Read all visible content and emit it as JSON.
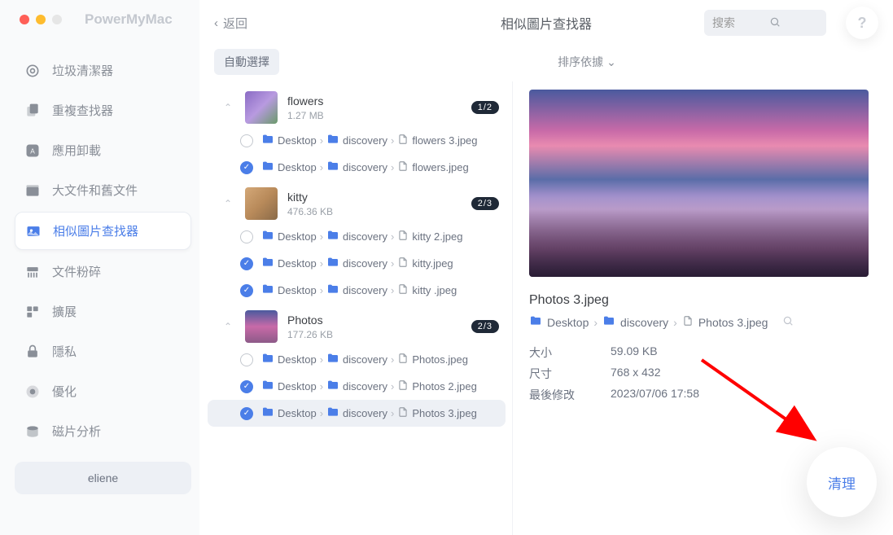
{
  "app": {
    "name": "PowerMyMac",
    "back": "返回",
    "page_title": "相似圖片查找器",
    "search_placeholder": "搜索",
    "help": "?"
  },
  "user": "eliene",
  "sidebar": {
    "items": [
      {
        "label": "垃圾清潔器",
        "icon": "broom-icon"
      },
      {
        "label": "重複查找器",
        "icon": "copy-icon"
      },
      {
        "label": "應用卸載",
        "icon": "app-icon"
      },
      {
        "label": "大文件和舊文件",
        "icon": "box-icon"
      },
      {
        "label": "相似圖片查找器",
        "icon": "image-icon"
      },
      {
        "label": "文件粉碎",
        "icon": "shred-icon"
      },
      {
        "label": "擴展",
        "icon": "puzzle-icon"
      },
      {
        "label": "隱私",
        "icon": "lock-icon"
      },
      {
        "label": "優化",
        "icon": "rocket-icon"
      },
      {
        "label": "磁片分析",
        "icon": "disk-icon"
      }
    ]
  },
  "subbar": {
    "auto_select": "自動選擇",
    "sort": "排序依據"
  },
  "groups": [
    {
      "name": "flowers",
      "size": "1.27 MB",
      "badge": "1/2",
      "thumb": "flowers",
      "files": [
        {
          "checked": false,
          "path": [
            "Desktop",
            "discovery"
          ],
          "file": "flowers 3.jpeg"
        },
        {
          "checked": true,
          "path": [
            "Desktop",
            "discovery"
          ],
          "file": "flowers.jpeg"
        }
      ]
    },
    {
      "name": "kitty",
      "size": "476.36 KB",
      "badge": "2/3",
      "thumb": "kitty",
      "files": [
        {
          "checked": false,
          "path": [
            "Desktop",
            "discovery"
          ],
          "file": "kitty 2.jpeg"
        },
        {
          "checked": true,
          "path": [
            "Desktop",
            "discovery"
          ],
          "file": "kitty.jpeg"
        },
        {
          "checked": true,
          "path": [
            "Desktop",
            "discovery"
          ],
          "file": "kitty .jpeg"
        }
      ]
    },
    {
      "name": "Photos",
      "size": "177.26 KB",
      "badge": "2/3",
      "thumb": "photos",
      "files": [
        {
          "checked": false,
          "path": [
            "Desktop",
            "discovery"
          ],
          "file": "Photos.jpeg"
        },
        {
          "checked": true,
          "path": [
            "Desktop",
            "discovery"
          ],
          "file": "Photos 2.jpeg"
        },
        {
          "checked": true,
          "path": [
            "Desktop",
            "discovery"
          ],
          "file": "Photos 3.jpeg",
          "selected": true
        }
      ]
    }
  ],
  "preview": {
    "name": "Photos 3.jpeg",
    "path": [
      "Desktop",
      "discovery",
      "Photos 3.jpeg"
    ],
    "meta": {
      "size_label": "大小",
      "size_value": "59.09 KB",
      "dim_label": "尺寸",
      "dim_value": "768 x 432",
      "mod_label": "最後修改",
      "mod_value": "2023/07/06 17:58"
    }
  },
  "clean_button": "清理"
}
